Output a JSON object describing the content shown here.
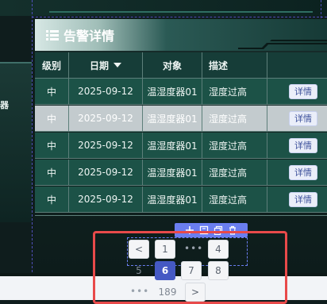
{
  "panel": {
    "title": "告警详情"
  },
  "left_fragment": "器",
  "table": {
    "headers": [
      "级别",
      "日期",
      "对象",
      "描述",
      ""
    ],
    "rows": [
      {
        "level": "中",
        "date": "2025-09-12",
        "object": "温湿度器01",
        "desc": "湿度过高",
        "action": "详情"
      },
      {
        "level": "中",
        "date": "2025-09-12",
        "object": "温湿度器01",
        "desc": "湿度过高",
        "action": "详情"
      },
      {
        "level": "中",
        "date": "2025-09-12",
        "object": "温湿度器01",
        "desc": "湿度过高",
        "action": "详情"
      },
      {
        "level": "中",
        "date": "2025-09-12",
        "object": "温湿度器01",
        "desc": "湿度过高",
        "action": "详情"
      },
      {
        "level": "中",
        "date": "2025-09-12",
        "object": "温湿度器01",
        "desc": "湿度过高",
        "action": "详情"
      }
    ]
  },
  "pagination": {
    "prev": "<",
    "next": ">",
    "pages_row1": [
      "1",
      "4"
    ],
    "pages_row2": [
      "5",
      "6",
      "7",
      "8"
    ],
    "ellipsis": "•••",
    "last": "189",
    "current": "6"
  },
  "toolbar_icons": [
    "plus-icon",
    "frame-icon",
    "copy-icon",
    "trash-icon"
  ],
  "colors": {
    "accent": "#4559c4",
    "toolbar": "#6a7ef0",
    "highlight_frame": "#e84a4a",
    "row_bg": "#1c5247",
    "row_highlight": "#c3cbce"
  }
}
